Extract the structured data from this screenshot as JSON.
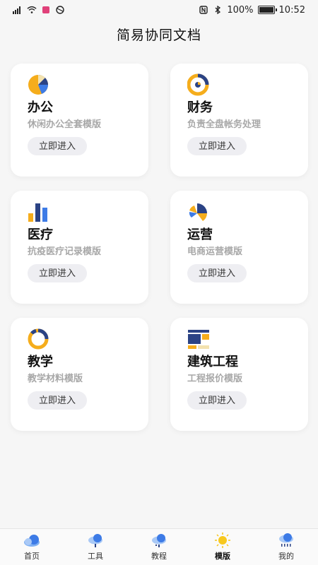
{
  "status_bar": {
    "battery": "100%",
    "time": "10:52"
  },
  "header": {
    "title": "简易协同文档"
  },
  "cards": [
    {
      "title": "办公",
      "subtitle": "休闲办公全套模版",
      "button": "立即进入",
      "icon": "pie-chart-icon"
    },
    {
      "title": "财务",
      "subtitle": "负责全盘帐务处理",
      "button": "立即进入",
      "icon": "donut-chart-icon"
    },
    {
      "title": "医疗",
      "subtitle": "抗疫医疗记录模版",
      "button": "立即进入",
      "icon": "bar-chart-icon"
    },
    {
      "title": "运营",
      "subtitle": "电商运营模版",
      "button": "立即进入",
      "icon": "radial-chart-icon"
    },
    {
      "title": "教学",
      "subtitle": "教学材料模版",
      "button": "立即进入",
      "icon": "ring-chart-icon"
    },
    {
      "title": "建筑工程",
      "subtitle": "工程报价模版",
      "button": "立即进入",
      "icon": "block-chart-icon"
    }
  ],
  "bottom_nav": {
    "items": [
      {
        "label": "首页",
        "icon": "cloud-home-icon"
      },
      {
        "label": "工具",
        "icon": "cloud-tools-icon"
      },
      {
        "label": "教程",
        "icon": "cloud-tutorial-icon"
      },
      {
        "label": "模版",
        "icon": "sun-icon",
        "active": true
      },
      {
        "label": "我的",
        "icon": "cloud-rain-icon"
      }
    ]
  },
  "colors": {
    "navy": "#2b4385",
    "amber": "#f5ad1c",
    "sky": "#3d7be6",
    "button_bg": "#eeeef2",
    "subtitle": "#a8a8a8"
  }
}
